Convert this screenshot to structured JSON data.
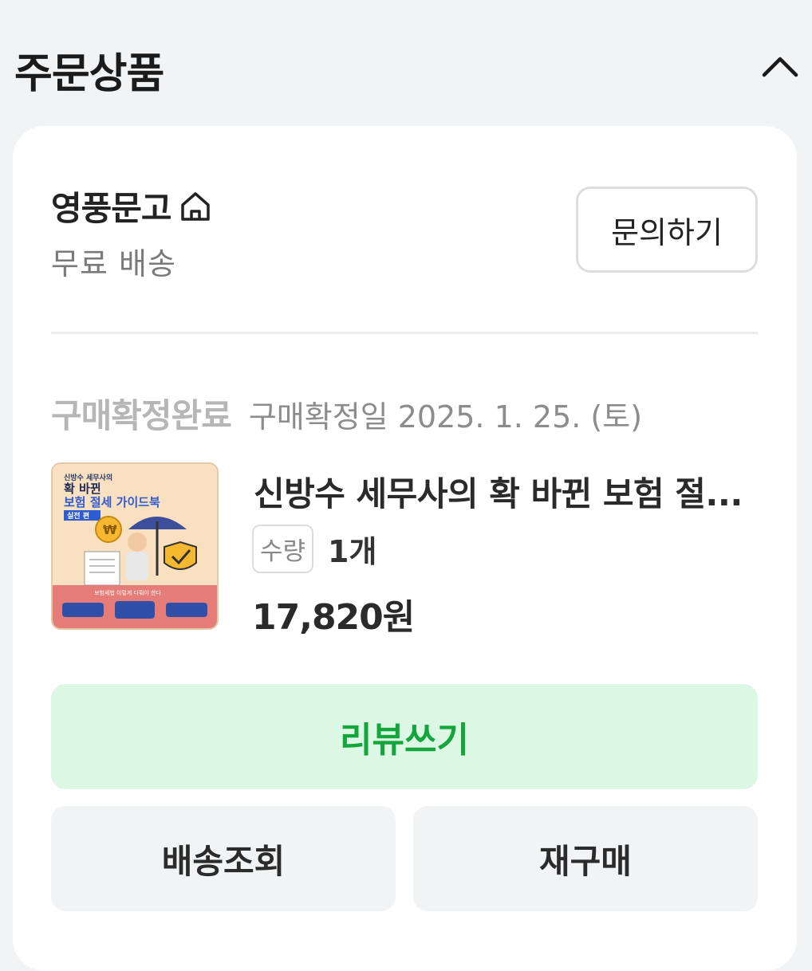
{
  "section": {
    "title": "주문상품",
    "collapse_icon": "chevron-up-icon"
  },
  "seller": {
    "name": "영풍문고",
    "home_icon": "home-icon",
    "shipping": "무료 배송",
    "inquiry_label": "문의하기"
  },
  "order": {
    "status": "구매확정완료",
    "confirm_date": "구매확정일 2025. 1. 25. (토)"
  },
  "product": {
    "title": "신방수 세무사의 확 바뀐 보험 절...",
    "qty_label": "수량",
    "qty_value": "1개",
    "price": "17,820원",
    "cover": {
      "author_line": "신방수 세무사의",
      "title_line1": "확 바뀐",
      "title_line2": "보험 절세 가이드북",
      "edition": "실전 편",
      "tagline": "보험세법 이렇게 다뤄야 한다",
      "coin_symbol": "₩"
    }
  },
  "actions": {
    "review": "리뷰쓰기",
    "tracking": "배송조회",
    "rebuy": "재구매"
  },
  "colors": {
    "background": "#f2f3f5",
    "review_bg": "#dcf7e3",
    "review_text": "#14a53d"
  }
}
